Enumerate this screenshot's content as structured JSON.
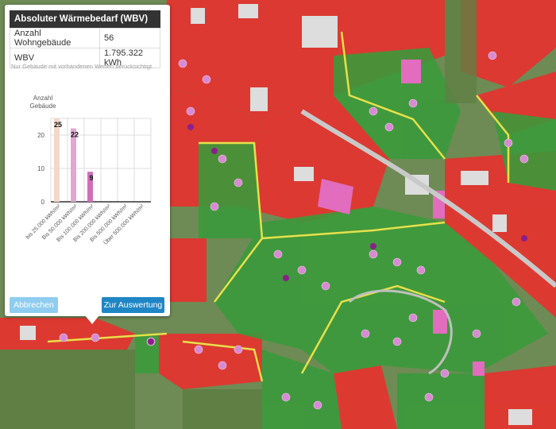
{
  "popup": {
    "title": "Absoluter Wärmebedarf (WBV)",
    "rows": [
      {
        "label": "Anzahl Wohngebäude",
        "value": "56"
      },
      {
        "label": "WBV",
        "value": "1.795.322 kWh"
      }
    ],
    "note": "Nur Gebäude mit vorhandenen Werten berücksichtigt.",
    "cancel_label": "Abbrechen",
    "evaluate_label": "Zur Auswertung"
  },
  "colors": {
    "header_bg": "#333333",
    "cancel_button": "#8ecdef",
    "evaluate_button": "#1f86c5",
    "map_red": "#e8312f",
    "map_green": "#3c9b3c",
    "building_pink": "#d78bd2"
  },
  "chart_data": {
    "type": "bar",
    "ylabel": "Anzahl Gebäude",
    "ylim": [
      0,
      25
    ],
    "yticks": [
      0,
      10,
      20
    ],
    "grid": true,
    "categories": [
      "bis 25.000 kWh/m²",
      "Bis 50.000 kWh/m²",
      "Bis 100.000 kWh/m²",
      "Bis 200.000 kWh/m²",
      "Bis 500.000 kWh/m²",
      "Über 500.000 kWh/m²"
    ],
    "values": [
      25,
      22,
      9,
      0,
      0,
      0
    ],
    "data_labels": [
      "25",
      "22",
      "9"
    ],
    "bar_colors": [
      "#f4d7c8",
      "#e2a6d2",
      "#cf6fba",
      "#b844a6",
      "#9c2d8e",
      "#7a1c74"
    ]
  }
}
